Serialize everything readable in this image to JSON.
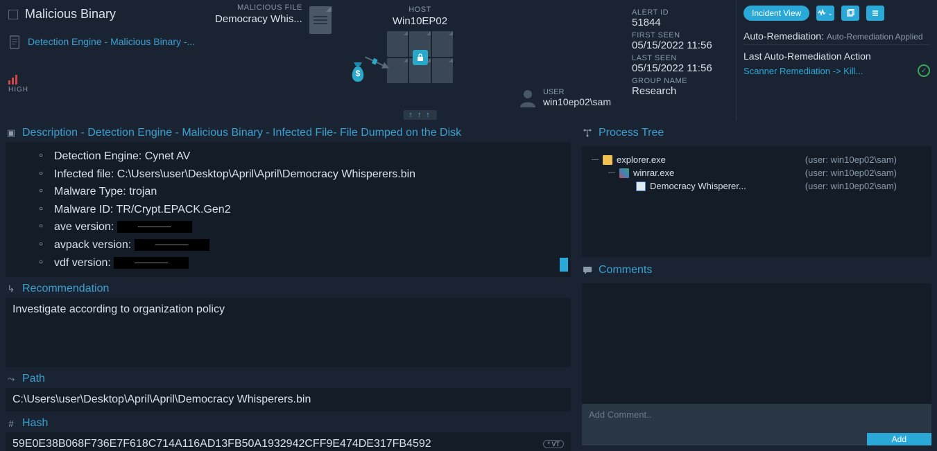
{
  "header": {
    "title": "Malicious Binary",
    "sublink": "Detection Engine - Malicious Binary -...",
    "severity": "HIGH",
    "malicious_file_label": "MALICIOUS FILE",
    "malicious_file_name": "Democracy Whis...",
    "host_label": "HOST",
    "host_name": "Win10EP02",
    "user_label": "USER",
    "user_name": "win10ep02\\sam"
  },
  "meta": {
    "alert_id_label": "ALERT ID",
    "alert_id": "51844",
    "first_seen_label": "FIRST SEEN",
    "first_seen": "05/15/2022 11:56",
    "last_seen_label": "LAST SEEN",
    "last_seen": "05/15/2022 11:56",
    "group_label": "GROUP NAME",
    "group": "Research"
  },
  "actions": {
    "incident_view": "Incident View",
    "auto_rem_label": "Auto-Remediation:",
    "auto_rem_value": "Auto-Remediation Applied",
    "last_action_label": "Last Auto-Remediation Action",
    "last_action_link": "Scanner Remediation -> Kill..."
  },
  "description": {
    "title": "Description - Detection Engine - Malicious Binary - Infected File- File Dumped on the Disk",
    "items": [
      "Detection Engine: Cynet AV",
      "Infected file: C:\\Users\\user\\Desktop\\April\\April\\Democracy Whisperers.bin",
      "Malware Type: trojan",
      "Malware ID: TR/Crypt.EPACK.Gen2"
    ],
    "ave_label": "ave version:",
    "avpack_label": "avpack version:",
    "vdf_label": "vdf version:"
  },
  "recommendation": {
    "title": "Recommendation",
    "text": "Investigate according to organization policy"
  },
  "path": {
    "title": "Path",
    "value": "C:\\Users\\user\\Desktop\\April\\April\\Democracy Whisperers.bin"
  },
  "hash": {
    "title": "Hash",
    "value": "59E0E38B068F736E7F618C714A116AD13FB50A1932942CFF9E474DE317FB4592",
    "vt_label": "VT"
  },
  "process_tree": {
    "title": "Process Tree",
    "rows": [
      {
        "level": 1,
        "name": "explorer.exe",
        "user": "(user: win10ep02\\sam)",
        "icon_color": "#f0c050"
      },
      {
        "level": 2,
        "name": "winrar.exe",
        "user": "(user: win10ep02\\sam)",
        "icon_color": "#c05050"
      },
      {
        "level": 3,
        "name": "Democracy Whisperer...",
        "user": "(user: win10ep02\\sam)",
        "icon_color": "#e0e8f0"
      }
    ]
  },
  "comments": {
    "title": "Comments",
    "placeholder": "Add Comment..",
    "add_btn": "Add"
  }
}
